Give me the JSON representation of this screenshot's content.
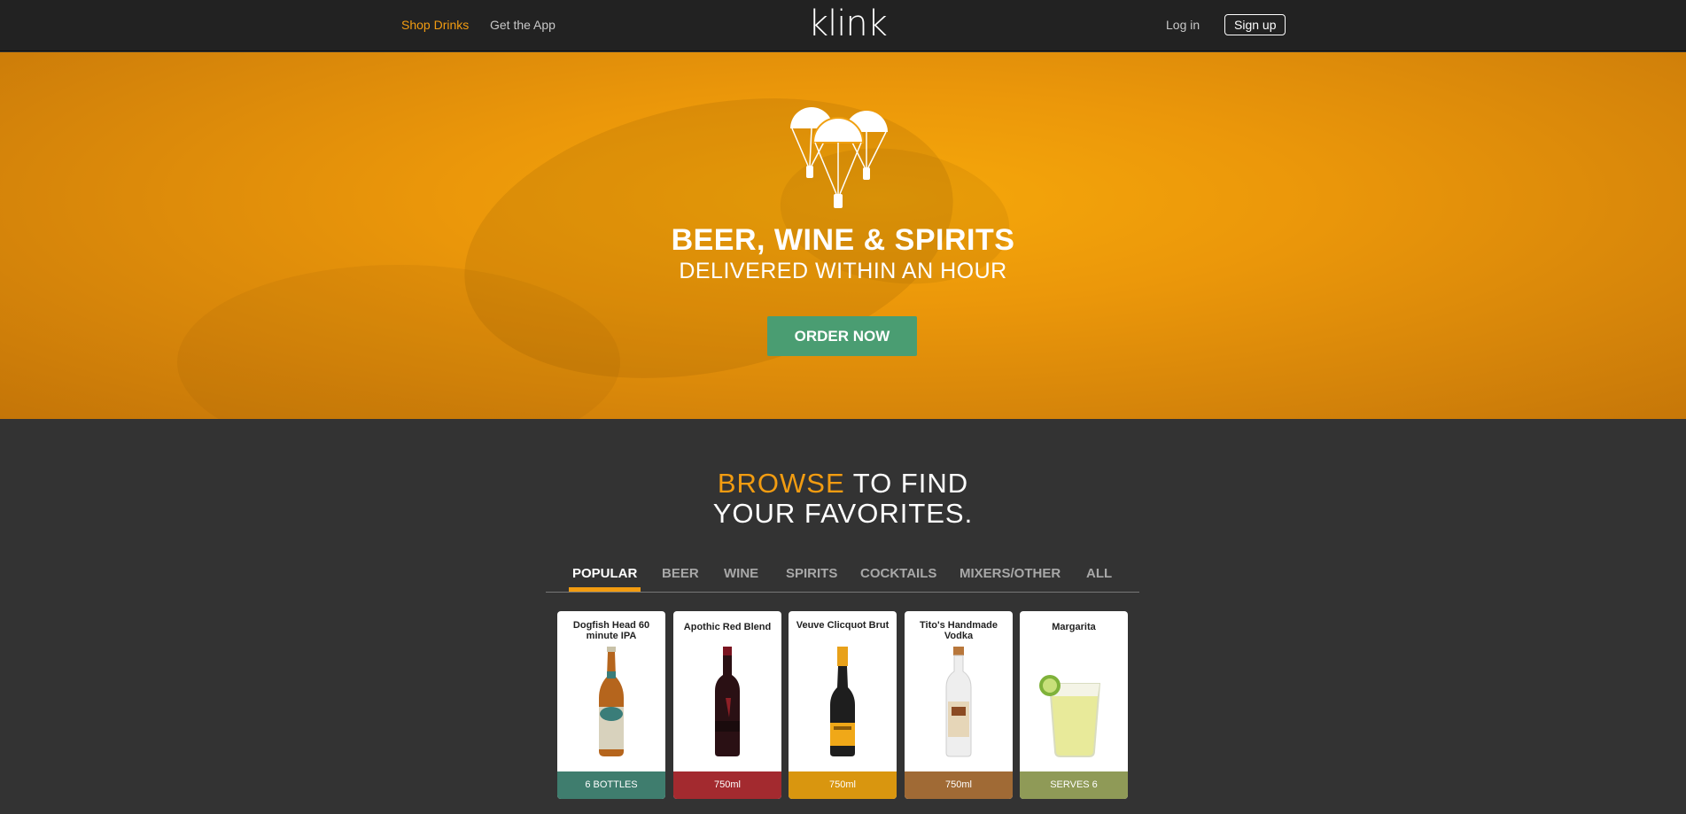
{
  "nav": {
    "shop_drinks": "Shop Drinks",
    "get_app": "Get the App",
    "logo": "klink",
    "login": "Log in",
    "signup": "Sign up"
  },
  "hero": {
    "title": "BEER, WINE & SPIRITS",
    "subtitle": "DELIVERED WITHIN AN HOUR",
    "order_button": "ORDER NOW",
    "icon": "parachute-delivery-icon"
  },
  "browse": {
    "highlight": "BROWSE",
    "line1_rest": " TO FIND",
    "line2": "YOUR FAVORITES."
  },
  "tabs": [
    {
      "label": "POPULAR",
      "active": true
    },
    {
      "label": "BEER"
    },
    {
      "label": "WINE"
    },
    {
      "label": "SPIRITS"
    },
    {
      "label": "COCKTAILS"
    },
    {
      "label": "MIXERS/OTHER"
    },
    {
      "label": "ALL"
    }
  ],
  "products": [
    {
      "name": "Dogfish Head 60 minute IPA",
      "footer": "6 BOTTLES",
      "color": "#3f7d6e",
      "icon": "beer-bottle-icon"
    },
    {
      "name": "Apothic Red Blend",
      "footer": "750ml",
      "color": "#a32a2f",
      "icon": "wine-bottle-icon"
    },
    {
      "name": "Veuve Clicquot Brut",
      "footer": "750ml",
      "color": "#d9960f",
      "icon": "champagne-bottle-icon"
    },
    {
      "name": "Tito's Handmade Vodka",
      "footer": "750ml",
      "color": "#a06a35",
      "icon": "vodka-bottle-icon"
    },
    {
      "name": "Margarita",
      "footer": "SERVES 6",
      "color": "#8f9a57",
      "icon": "margarita-glass-icon"
    }
  ],
  "colors": {
    "accent": "#f29c11",
    "nav_bg": "#222222",
    "body_bg": "#333333",
    "order_button": "#4a9d72"
  }
}
